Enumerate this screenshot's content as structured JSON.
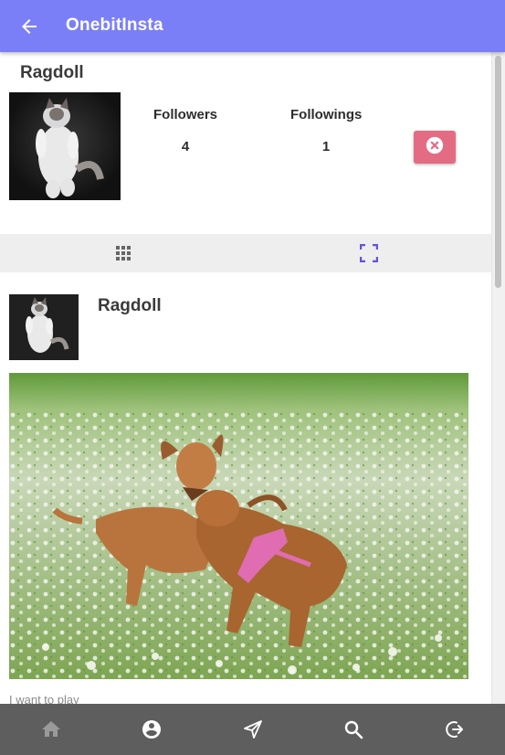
{
  "app": {
    "title": "OnebitInsta"
  },
  "header": {
    "back_icon": "arrow-left-icon"
  },
  "profile": {
    "name": "Ragdoll",
    "followers_label": "Followers",
    "followers_count": "4",
    "followings_label": "Followings",
    "followings_count": "1",
    "unfollow_icon": "close-circle-icon",
    "avatar_subject": "ragdoll cat"
  },
  "view_toggle": {
    "grid_icon": "grid-icon",
    "list_icon": "fullscreen-icon",
    "active": "list"
  },
  "post": {
    "author": "Ragdoll",
    "image_subject": "two puppies playing in a clover field",
    "caption": "I want to play"
  },
  "bottom_nav": {
    "items": [
      {
        "icon": "home-icon",
        "active": false
      },
      {
        "icon": "account-icon",
        "active": true
      },
      {
        "icon": "send-icon",
        "active": true
      },
      {
        "icon": "search-icon",
        "active": true
      },
      {
        "icon": "logout-icon",
        "active": true
      }
    ]
  },
  "colors": {
    "primary": "#7b7ff7",
    "accent": "#6a4fd8",
    "unfollow": "#e36c84",
    "nav_background": "#5e5e5e",
    "nav_icon_active": "#ffffff",
    "nav_icon_inactive": "#9a9a9a"
  }
}
